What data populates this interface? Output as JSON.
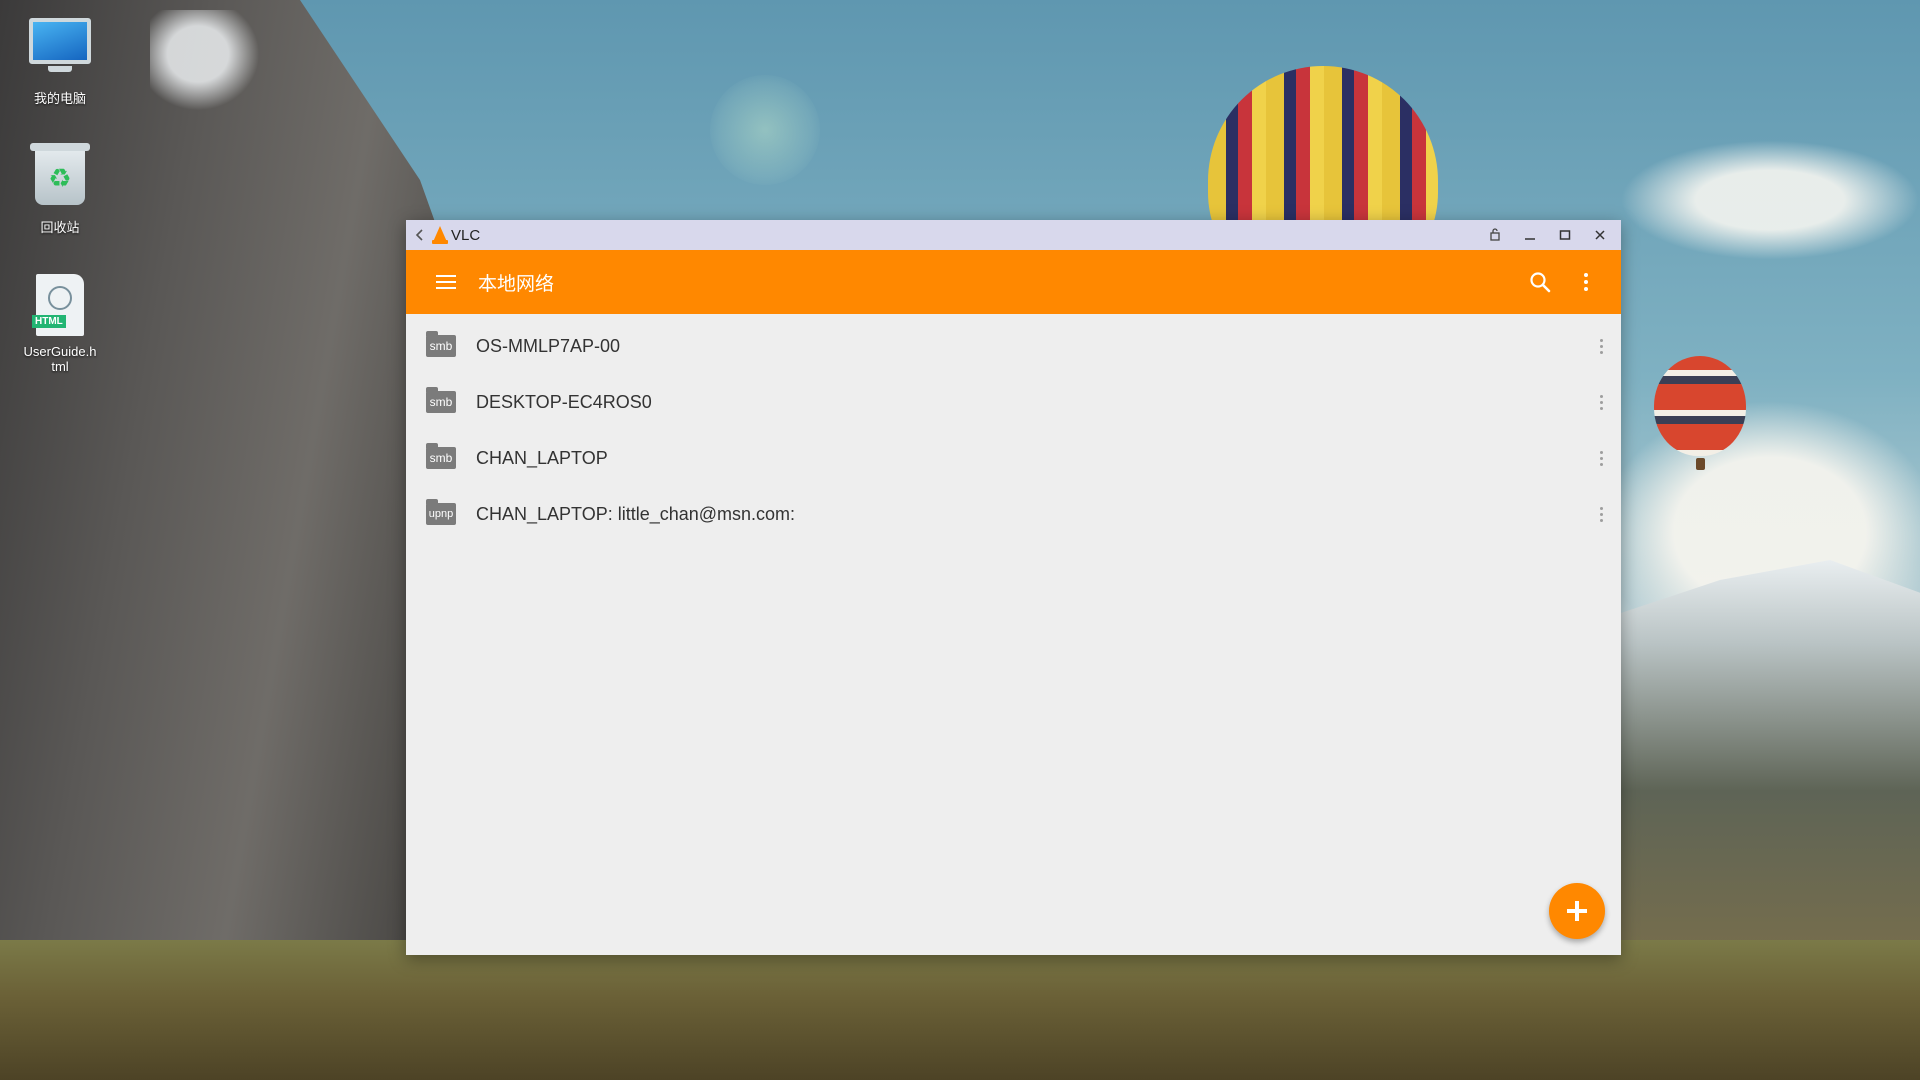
{
  "desktop": {
    "icons": [
      {
        "label": "我的电脑",
        "icon": "computer-icon"
      },
      {
        "label": "回收站",
        "icon": "recycle-bin-icon"
      },
      {
        "label": "UserGuide.h\ntml",
        "icon": "html-file-icon"
      }
    ]
  },
  "window": {
    "title": "VLC",
    "titlebar_icons": [
      "back-icon",
      "vlc-cone-icon",
      "rotate-icon",
      "minimize-icon",
      "maximize-icon",
      "close-icon"
    ]
  },
  "appbar": {
    "title": "本地网络",
    "icons": [
      "hamburger-menu-icon",
      "search-icon",
      "more-options-icon"
    ],
    "color": "#ff8800"
  },
  "network_items": [
    {
      "type": "smb",
      "name": "OS-MMLP7AP-00"
    },
    {
      "type": "smb",
      "name": "DESKTOP-EC4ROS0"
    },
    {
      "type": "smb",
      "name": "CHAN_LAPTOP"
    },
    {
      "type": "upnp",
      "name": "CHAN_LAPTOP: little_chan@msn.com:"
    }
  ],
  "fab": {
    "icon": "plus-icon"
  }
}
